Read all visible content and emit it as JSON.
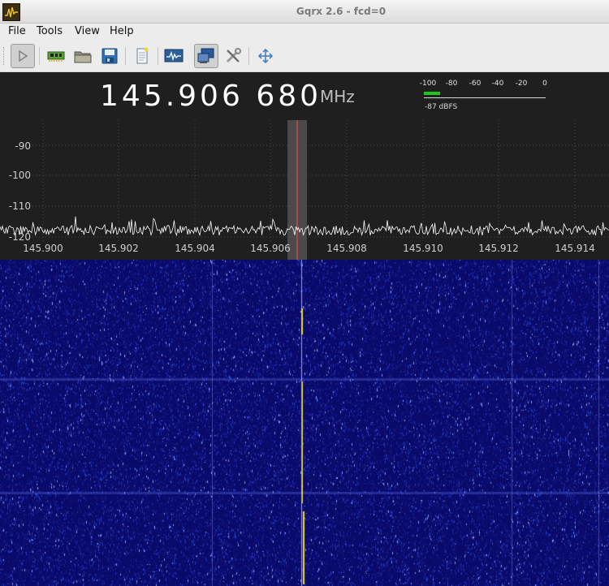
{
  "window": {
    "title": "Gqrx 2.6 - fcd=0"
  },
  "menu": [
    {
      "label": "File",
      "key": "F"
    },
    {
      "label": "Tools",
      "key": "T"
    },
    {
      "label": "View",
      "key": "V"
    },
    {
      "label": "Help",
      "key": "H"
    }
  ],
  "toolbar": {
    "buttons": [
      "play-icon",
      "hardware-board-icon",
      "folder-open-icon",
      "save-icon",
      "notes-icon",
      "waveform-icon",
      "remote-control-icon",
      "tools-icon",
      "fullscreen-icon"
    ]
  },
  "receiver": {
    "frequency_display": "145.906 680",
    "unit": "MHz"
  },
  "meter": {
    "scale": [
      "-100",
      "-80",
      "-60",
      "-40",
      "-20",
      "0"
    ],
    "readout": "-87 dBFS",
    "level_dbfs": -87
  },
  "spectrum": {
    "y_labels": [
      "-90",
      "-100",
      "-110",
      "-120"
    ],
    "x_labels": [
      "145.900",
      "145.902",
      "145.904",
      "145.906",
      "145.908",
      "145.910",
      "145.912",
      "145.914"
    ]
  },
  "colors": {
    "waterfall_bg": "#0a0a6a",
    "signal": "#f0e020",
    "filter_line": "#ff4040",
    "meter_bar": "#22c41c"
  }
}
